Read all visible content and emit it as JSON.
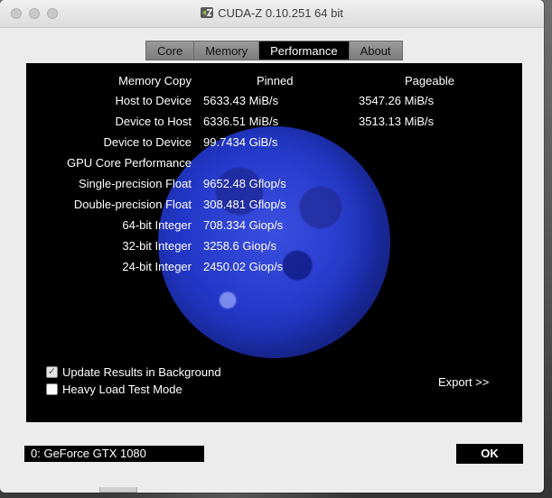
{
  "window": {
    "title": "CUDA-Z 0.10.251 64 bit"
  },
  "tabs": [
    {
      "label": "Core",
      "active": false
    },
    {
      "label": "Memory",
      "active": false
    },
    {
      "label": "Performance",
      "active": true
    },
    {
      "label": "About",
      "active": false
    }
  ],
  "table": {
    "header": {
      "label": "Memory Copy",
      "col1": "Pinned",
      "col2": "Pageable"
    },
    "rows": [
      {
        "label": "Host to Device",
        "pinned": "5633.43 MiB/s",
        "pageable": "3547.26 MiB/s"
      },
      {
        "label": "Device to Host",
        "pinned": "6336.51 MiB/s",
        "pageable": "3513.13 MiB/s"
      },
      {
        "label": "Device to Device",
        "pinned": "99.7434 GiB/s",
        "pageable": ""
      },
      {
        "label": "GPU Core Performance",
        "pinned": "",
        "pageable": ""
      },
      {
        "label": "Single-precision Float",
        "pinned": "9652.48 Gflop/s",
        "pageable": ""
      },
      {
        "label": "Double-precision Float",
        "pinned": "308.481 Gflop/s",
        "pageable": ""
      },
      {
        "label": "64-bit Integer",
        "pinned": "708.334 Giop/s",
        "pageable": ""
      },
      {
        "label": "32-bit Integer",
        "pinned": "3258.6 Giop/s",
        "pageable": ""
      },
      {
        "label": "24-bit Integer",
        "pinned": "2450.02 Giop/s",
        "pageable": ""
      }
    ]
  },
  "options": {
    "update_background": {
      "label": "Update Results in Background",
      "checked": true
    },
    "heavy_load": {
      "label": "Heavy Load Test Mode",
      "checked": false
    }
  },
  "export_label": "Export >>",
  "device": "0: GeForce GTX 1080",
  "ok_label": "OK",
  "colors": {
    "panel_bg": "#000000",
    "moon": "#2237c7",
    "tab_active_bg": "#000000"
  }
}
